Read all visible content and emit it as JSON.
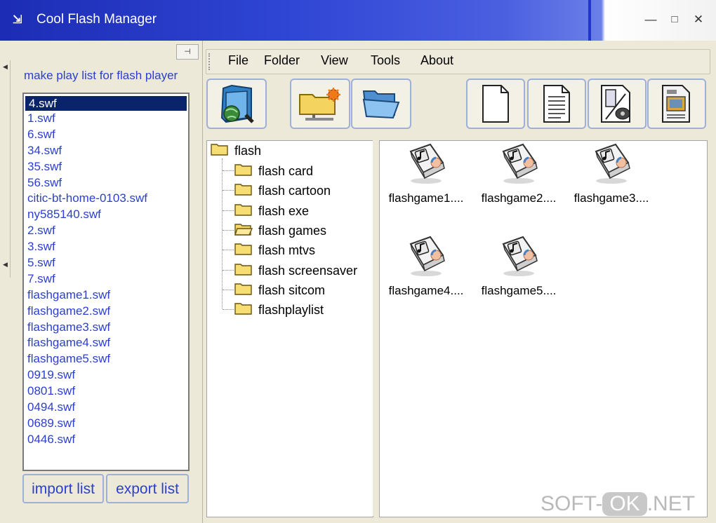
{
  "window": {
    "title": "Cool Flash Manager",
    "title_icon": "⇲",
    "controls": {
      "minimize": "—",
      "maximize": "□",
      "close": "✕"
    },
    "colors": {
      "titlebar": "#2f45d4",
      "accent_text": "#2b3fcf",
      "selection": "#0a246a"
    }
  },
  "left_panel": {
    "pin_glyph": "⊣",
    "heading": "make play list for flash player",
    "items": [
      "4.swf",
      "1.swf",
      "6.swf",
      "34.swf",
      "35.swf",
      "56.swf",
      "citic-bt-home-0103.swf",
      "ny585140.swf",
      "2.swf",
      "3.swf",
      "5.swf",
      "7.swf",
      "flashgame1.swf",
      "flashgame2.swf",
      "flashgame3.swf",
      "flashgame4.swf",
      "flashgame5.swf",
      "0919.swf",
      "0801.swf",
      "0494.swf",
      "0689.swf",
      "0446.swf"
    ],
    "selected_index": 0,
    "import_label": "import list",
    "export_label": "export list"
  },
  "menu": {
    "file": "File",
    "folder": "Folder",
    "view": "View",
    "tools": "Tools",
    "about": "About"
  },
  "toolbar": {
    "buttons": [
      "web-folder-icon",
      "folder-settings-icon",
      "open-folder-icon",
      "blank-page-icon",
      "text-page-icon",
      "device-page-icon",
      "image-page-icon"
    ]
  },
  "tree": {
    "root": "flash",
    "children": [
      "flash card",
      "flash cartoon",
      "flash exe",
      "flash games",
      "flash mtvs",
      "flash screensaver",
      "flash sitcom",
      "flashplaylist"
    ],
    "open_child": "flash games"
  },
  "files": [
    "flashgame1....",
    "flashgame2....",
    "flashgame3....",
    "flashgame4....",
    "flashgame5...."
  ],
  "watermark": {
    "pre": "SOFT-",
    "ok": "OK",
    "post": ".NET"
  }
}
